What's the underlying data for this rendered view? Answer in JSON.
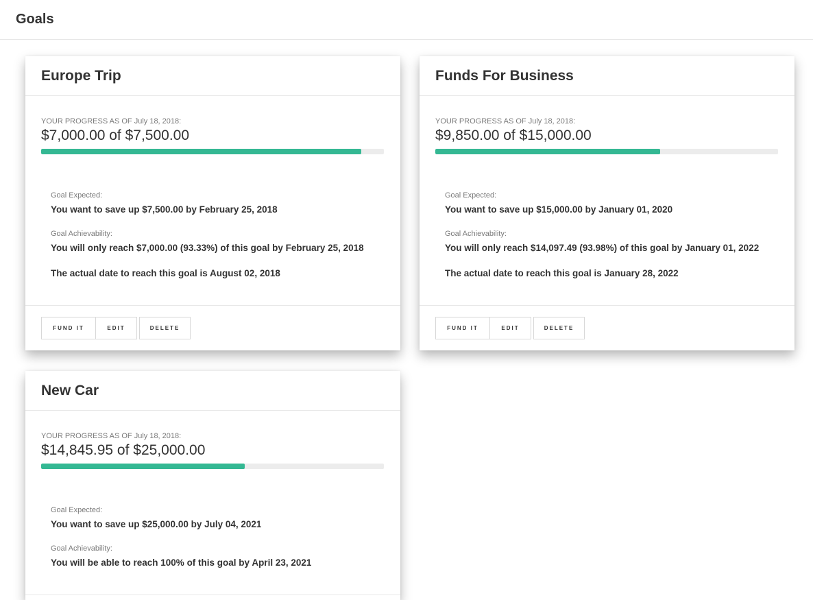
{
  "page": {
    "title": "Goals"
  },
  "colors": {
    "progress_fill": "#34b893",
    "progress_track": "#ececec"
  },
  "goals": [
    {
      "title": "Europe Trip",
      "progress_label": "YOUR PROGRESS AS OF",
      "progress_date": "July 18, 2018:",
      "progress_amount": "$7,000.00 of $7,500.00",
      "progress_fraction": 0.9333,
      "expected_label": "Goal Expected:",
      "expected_value": "You want to save up $7,500.00 by February 25, 2018",
      "achievability_label": "Goal Achievability:",
      "achievability_value": "You will only reach $7,000.00 (93.33%) of this goal by February 25, 2018",
      "actual_date": "The actual date to reach this goal is August 02, 2018",
      "buttons": {
        "fund": "FUND IT",
        "edit": "EDIT",
        "delete": "DELETE"
      }
    },
    {
      "title": "Funds For Business",
      "progress_label": "YOUR PROGRESS AS OF",
      "progress_date": "July 18, 2018:",
      "progress_amount": "$9,850.00 of $15,000.00",
      "progress_fraction": 0.6567,
      "expected_label": "Goal Expected:",
      "expected_value": "You want to save up $15,000.00 by January 01, 2020",
      "achievability_label": "Goal Achievability:",
      "achievability_value": "You will only reach $14,097.49 (93.98%) of this goal by January 01, 2022",
      "actual_date": "The actual date to reach this goal is January 28, 2022",
      "buttons": {
        "fund": "FUND IT",
        "edit": "EDIT",
        "delete": "DELETE"
      }
    },
    {
      "title": "New Car",
      "progress_label": "YOUR PROGRESS AS OF",
      "progress_date": "July 18, 2018:",
      "progress_amount": "$14,845.95 of $25,000.00",
      "progress_fraction": 0.5938,
      "expected_label": "Goal Expected:",
      "expected_value": "You want to save up $25,000.00 by July 04, 2021",
      "achievability_label": "Goal Achievability:",
      "achievability_value": "You will be able to reach 100% of this goal by April 23, 2021"
    }
  ]
}
